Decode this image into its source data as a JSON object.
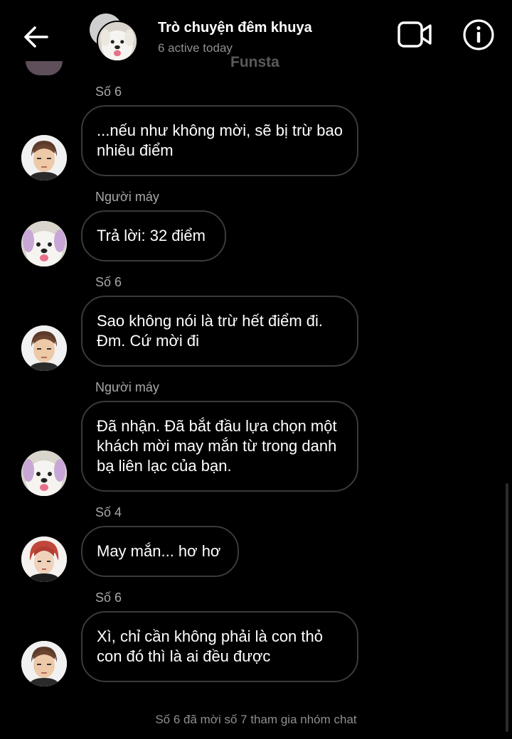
{
  "header": {
    "title": "Trò chuyện đêm khuya",
    "subtitle": "6 active today",
    "watermark": "Funsta",
    "icons": {
      "back": "arrow-left-icon",
      "video": "video-camera-icon",
      "info": "info-icon"
    }
  },
  "messages": [
    {
      "sender": "Số 6",
      "text": "...nếu như không mời, sẽ bị trừ bao nhiêu điểm",
      "avatar": "boy-avatar"
    },
    {
      "sender": "Người máy",
      "text": "Trả lời: 32 điểm",
      "avatar": "dog-avatar"
    },
    {
      "sender": "Số 6",
      "text": "Sao không nói là trừ hết điểm đi. Đm. Cứ mời đi",
      "avatar": "boy-avatar"
    },
    {
      "sender": "Người máy",
      "text": "Đã nhận. Đã bắt đầu lựa chọn một khách mời may mắn từ trong danh bạ liên lạc của bạn.",
      "avatar": "dog-avatar"
    },
    {
      "sender": "Số 4",
      "text": "May mắn... hơ hơ",
      "avatar": "redhair-avatar"
    },
    {
      "sender": "Số 6",
      "text": "Xì, chỉ cần không phải là con thỏ con đó thì là ai đều được",
      "avatar": "boy-avatar"
    }
  ],
  "system_message": "Số 6 đã mời số 7 tham gia nhóm chat",
  "colors": {
    "background": "#000000",
    "bubble_border": "#3a3a3a",
    "sender_text": "#a8a8a8",
    "muted_text": "#8e8e8e"
  }
}
